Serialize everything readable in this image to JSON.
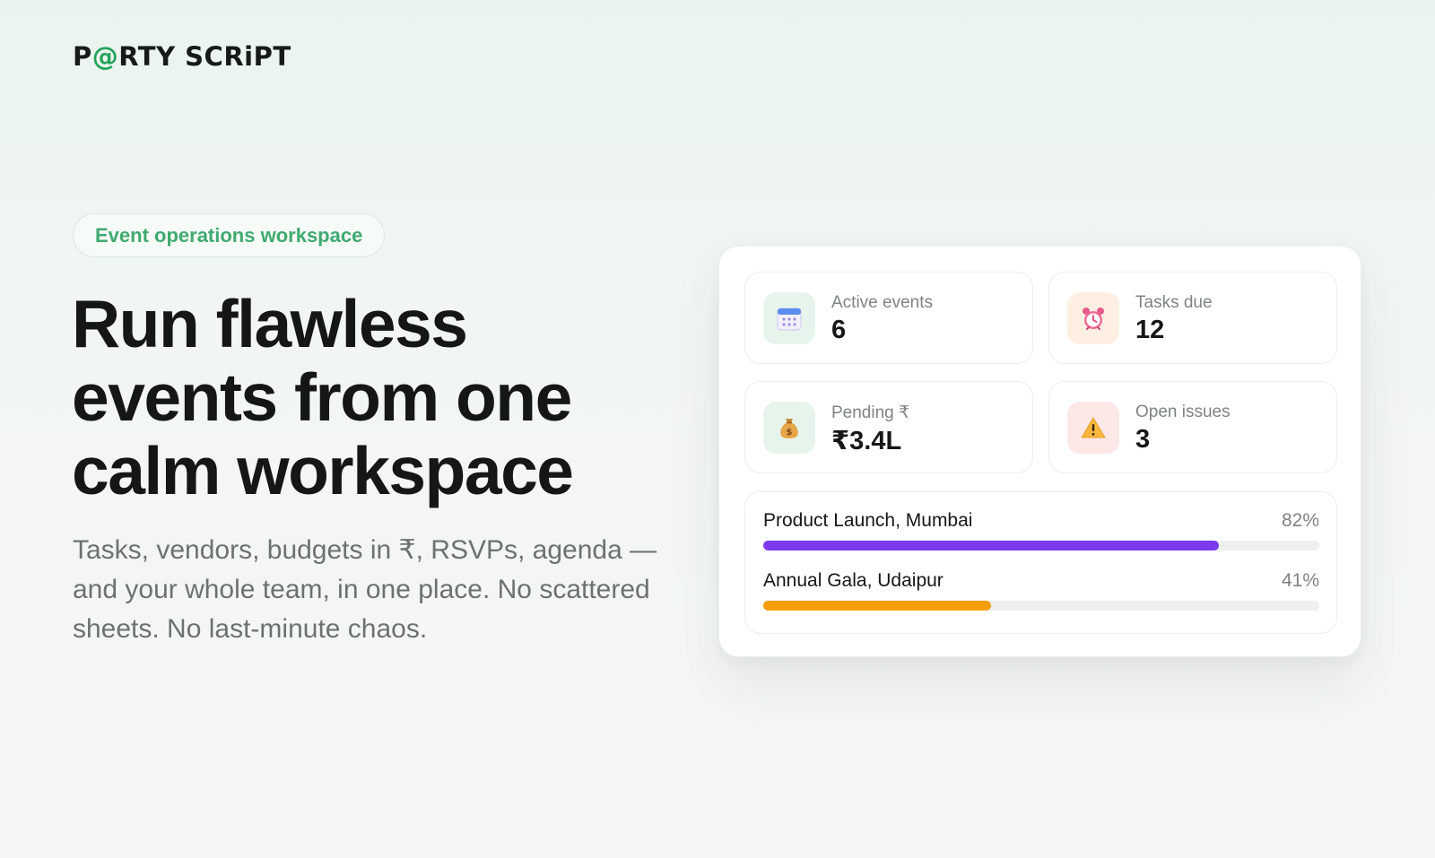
{
  "brand": {
    "logo_pre": "P",
    "logo_at": "@",
    "logo_post": "RTY SCRiPT"
  },
  "hero": {
    "tag": "Event operations workspace",
    "headline": "Run flawless events from one calm workspace",
    "subheadline": "Tasks, vendors, budgets in ₹, RSVPs, agenda — and your whole team, in one place. No scattered sheets. No last-minute chaos."
  },
  "dashboard": {
    "stats": [
      {
        "label": "Active events",
        "value": "6",
        "icon": "calendar-icon"
      },
      {
        "label": "Tasks due",
        "value": "12",
        "icon": "alarm-clock-icon"
      },
      {
        "label": "Pending ₹",
        "value": "₹3.4L",
        "icon": "money-bag-icon"
      },
      {
        "label": "Open issues",
        "value": "3",
        "icon": "warning-icon"
      }
    ],
    "events": [
      {
        "name": "Product Launch, Mumbai",
        "percent_label": "82%",
        "progress": 0.82,
        "color": "#7c3aed"
      },
      {
        "name": "Annual Gala, Udaipur",
        "percent_label": "41%",
        "progress": 0.41,
        "color": "#f59e0b"
      }
    ]
  },
  "colors": {
    "accent": "#22a35a",
    "tag_text": "#3faa6e"
  }
}
